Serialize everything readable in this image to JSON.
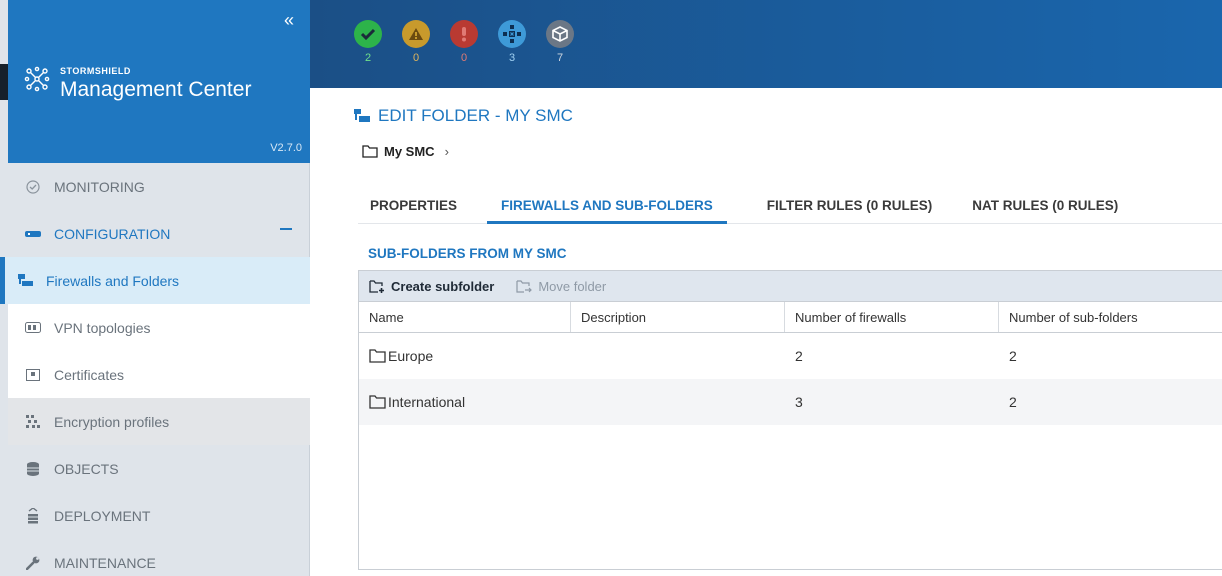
{
  "brand": {
    "collapse_glyph": "«",
    "logo_small": "STORMSHIELD",
    "logo_big": "Management Center",
    "version": "V2.7.0"
  },
  "nav": {
    "monitoring": "MONITORING",
    "configuration": "CONFIGURATION",
    "sub_items": {
      "firewalls": "Firewalls and Folders",
      "vpn": "VPN topologies",
      "certificates": "Certificates",
      "encryption": "Encryption profiles"
    },
    "objects": "OBJECTS",
    "deployment": "DEPLOYMENT",
    "maintenance": "MAINTENANCE"
  },
  "status": [
    {
      "name": "ok",
      "count": "2",
      "color": "#2db34a",
      "count_color": "#6fe08a"
    },
    {
      "name": "warning",
      "count": "0",
      "color": "#c89a2c",
      "count_color": "#e0b55c"
    },
    {
      "name": "critical",
      "count": "0",
      "color": "#b93a32",
      "count_color": "#e07a74"
    },
    {
      "name": "network",
      "count": "3",
      "color": "#3e9ad8",
      "count_color": "#9fd0f2"
    },
    {
      "name": "box",
      "count": "7",
      "color": "#6b7786",
      "count_color": "#d0d8e0"
    }
  ],
  "page": {
    "title": "EDIT FOLDER - MY SMC",
    "breadcrumb": "My SMC",
    "breadcrumb_sep": "›",
    "tabs": [
      "PROPERTIES",
      "FIREWALLS AND SUB-FOLDERS",
      "FILTER RULES (0 RULES)",
      "NAT RULES (0 RULES)"
    ],
    "section_title": "SUB-FOLDERS FROM MY SMC"
  },
  "toolbar": {
    "create": "Create subfolder",
    "move": "Move folder"
  },
  "table": {
    "headers": [
      "Name",
      "Description",
      "Number of firewalls",
      "Number of sub-folders"
    ],
    "rows": [
      {
        "name": "Europe",
        "description": "",
        "firewalls": "2",
        "subfolders": "2"
      },
      {
        "name": "International",
        "description": "",
        "firewalls": "3",
        "subfolders": "2"
      }
    ]
  },
  "colors": {
    "accent": "#1f77c0"
  }
}
